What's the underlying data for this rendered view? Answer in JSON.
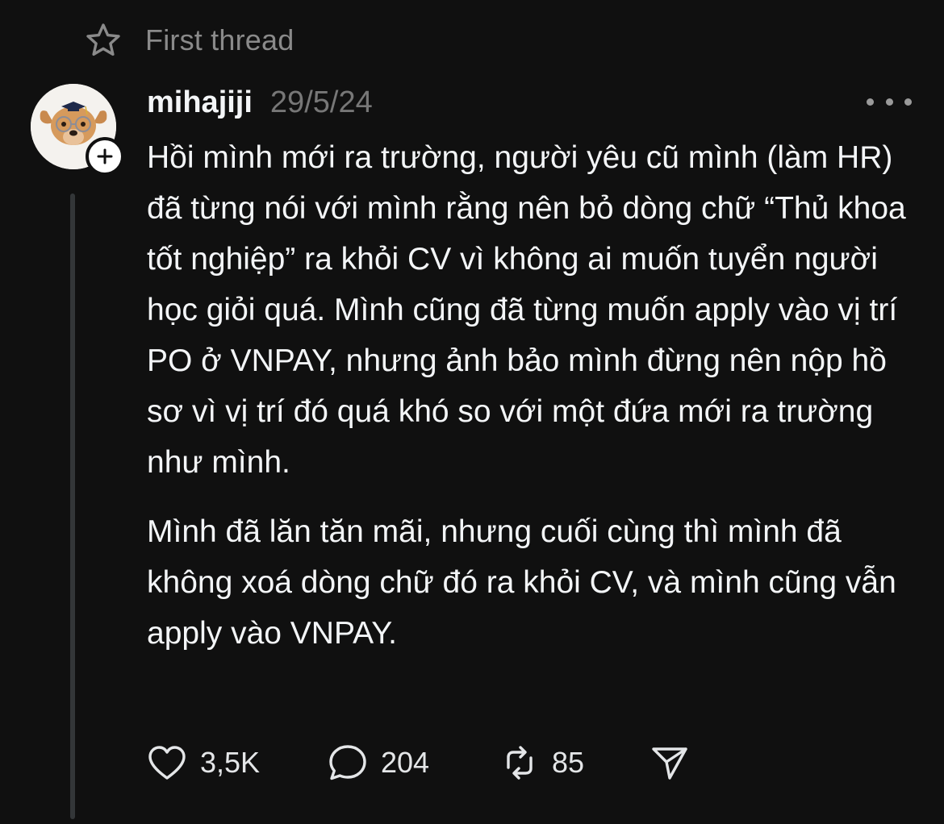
{
  "thread": {
    "label": "First thread",
    "label_icon": "star-icon"
  },
  "post": {
    "username": "mihajiji",
    "date": "29/5/24",
    "avatar_icon": "dog-with-graduation-cap-avatar",
    "paragraphs": [
      "Hồi mình mới ra trường, người yêu cũ mình (làm HR) đã từng nói với mình rằng nên bỏ dòng chữ “Thủ khoa tốt nghiệp” ra khỏi CV vì không ai muốn tuyển người học giỏi quá. Mình cũng đã từng muốn apply vào vị trí PO ở VNPAY, nhưng ảnh bảo mình đừng nên nộp hồ sơ vì vị trí đó quá khó so với một đứa mới ra trường như mình.",
      "Mình đã lăn tăn mãi, nhưng cuối cùng thì mình đã không xoá dòng chữ đó ra khỏi CV, và mình cũng vẫn apply vào VNPAY."
    ]
  },
  "actions": {
    "likes": "3,5K",
    "replies": "204",
    "reposts": "85"
  },
  "colors": {
    "background": "#101010",
    "text_primary": "#f3f5f7",
    "text_secondary": "#777777",
    "thread_line": "#333638"
  }
}
